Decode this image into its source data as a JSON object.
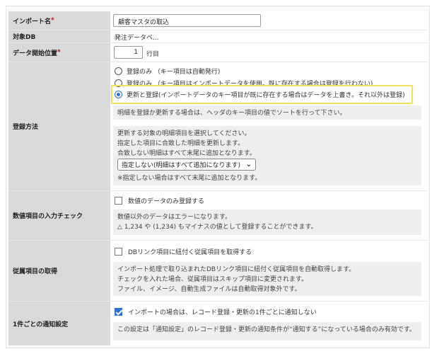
{
  "rows": {
    "import_name": {
      "label": "インポート名",
      "required_mark": "*",
      "value": "顧客マスタの取込"
    },
    "target_db": {
      "label": "対象DB",
      "value": "発注データベ..."
    },
    "start_position": {
      "label": "データ開始位置",
      "required_mark": "*",
      "value": "1",
      "suffix": "行目"
    },
    "registration_method": {
      "label": "登録方法",
      "options": [
        {
          "label": "登録のみ （キー項目は自動発行)",
          "selected": false
        },
        {
          "label": "登録のみ （キー項目はインポートデータを使用。既に存在する場合は登録を行わない)",
          "selected": false
        },
        {
          "label": "更新と登録(インポートデータのキー項目が既に存在する場合はデータを上書き。それ以外は登録)",
          "selected": true
        }
      ],
      "note": "明細を登録か更新する場合は、ヘッダのキー項目の値でソートを行って下さい。",
      "detail_lines": [
        "更新する対象の明細項目を選択してください。",
        "指定した項目に合致した明細を更新します。",
        "合致しない明細はすべて末尾に追加となります。"
      ],
      "select_value": "指定しない(明細はすべて追加になります)",
      "select_note": "※指定しない場合はすべて末尾に追加となります。"
    },
    "numeric_check": {
      "label": "数値項目の入力チェック",
      "checkbox_label": "数値のデータのみ登録する",
      "checked": false,
      "note_lines": [
        "数値以外のデータはエラーになります。",
        "△ 1,234 や (1,234) もマイナスの値として登録することができます。"
      ]
    },
    "linked_fetch": {
      "label": "従属項目の取得",
      "checkbox_label": "DBリンク項目に紐付く従属項目を取得する",
      "checked": false,
      "note_lines": [
        "インポート処理で取り込まれたDBリンク項目に紐付く従属項目を自動取得します。",
        "チェックを入れた場合、従属項目はスキップ項目に変更されます。",
        "ファイル、イメージ、自動生成ファイルは自動取得対象外です。"
      ]
    },
    "notify": {
      "label": "1件ごとの通知設定",
      "checkbox_label": "インポートの場合は、レコード登録・更新の1件ごとに通知しない",
      "checked": true,
      "note": "この設定は「通知設定」のレコード登録・更新の通知条件が“通知する”になっている場合のみ有効です。"
    }
  },
  "colors": {
    "label_bg": "#d9d9d9",
    "highlight": "#f2e05a",
    "accent": "#2a6fd6",
    "required": "#d40000"
  },
  "icons": {
    "select_arrow": "chevron-down-icon",
    "check": "checkmark-icon"
  }
}
